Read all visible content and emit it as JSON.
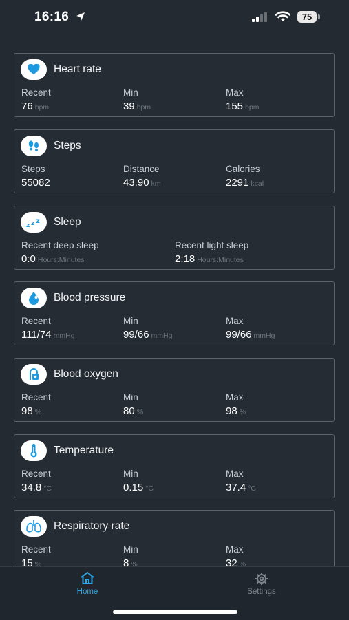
{
  "status_bar": {
    "time": "16:16",
    "battery": "75"
  },
  "cards": [
    {
      "title": "Heart rate",
      "icon": "heart-icon",
      "metrics": [
        {
          "label": "Recent",
          "value": "76",
          "unit": "bpm"
        },
        {
          "label": "Min",
          "value": "39",
          "unit": "bpm"
        },
        {
          "label": "Max",
          "value": "155",
          "unit": "bpm"
        }
      ]
    },
    {
      "title": "Steps",
      "icon": "footprints-icon",
      "metrics": [
        {
          "label": "Steps",
          "value": "55082",
          "unit": ""
        },
        {
          "label": "Distance",
          "value": "43.90",
          "unit": "km"
        },
        {
          "label": "Calories",
          "value": "2291",
          "unit": "kcal"
        }
      ]
    },
    {
      "title": "Sleep",
      "icon": "sleep-zzz-icon",
      "metrics": [
        {
          "label": "Recent deep sleep",
          "value": "0:0",
          "unit": "Hours:Minutes"
        },
        {
          "label": "Recent light sleep",
          "value": "2:18",
          "unit": "Hours:Minutes"
        }
      ]
    },
    {
      "title": "Blood pressure",
      "icon": "blood-drop-icon",
      "metrics": [
        {
          "label": "Recent",
          "value": "111/74",
          "unit": "mmHg"
        },
        {
          "label": "Min",
          "value": "99/66",
          "unit": "mmHg"
        },
        {
          "label": "Max",
          "value": "99/66",
          "unit": "mmHg"
        }
      ]
    },
    {
      "title": "Blood oxygen",
      "icon": "blood-oxygen-icon",
      "metrics": [
        {
          "label": "Recent",
          "value": "98",
          "unit": "%"
        },
        {
          "label": "Min",
          "value": "80",
          "unit": "%"
        },
        {
          "label": "Max",
          "value": "98",
          "unit": "%"
        }
      ]
    },
    {
      "title": "Temperature",
      "icon": "thermometer-icon",
      "metrics": [
        {
          "label": "Recent",
          "value": "34.8",
          "unit": "°C"
        },
        {
          "label": "Min",
          "value": "0.15",
          "unit": "°C"
        },
        {
          "label": "Max",
          "value": "37.4",
          "unit": "°C"
        }
      ]
    },
    {
      "title": "Respiratory rate",
      "icon": "lungs-icon",
      "metrics": [
        {
          "label": "Recent",
          "value": "15",
          "unit": "%"
        },
        {
          "label": "Min",
          "value": "8",
          "unit": "%"
        },
        {
          "label": "Max",
          "value": "32",
          "unit": "%"
        }
      ]
    }
  ],
  "tabs": [
    {
      "label": "Home",
      "icon": "home-icon",
      "active": true
    },
    {
      "label": "Settings",
      "icon": "gear-icon",
      "active": false
    }
  ],
  "colors": {
    "accent": "#2fa6e6",
    "background": "#232a31",
    "card_border": "#5b636c"
  }
}
